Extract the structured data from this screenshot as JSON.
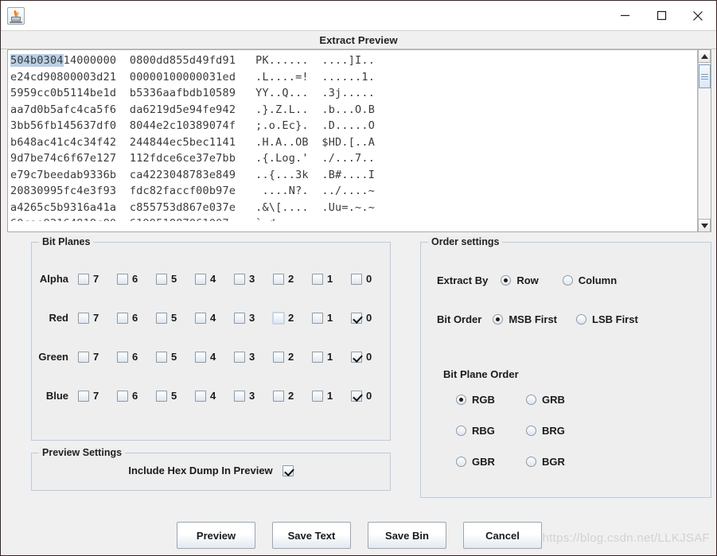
{
  "window": {
    "app_icon": "java-coffee-cup-icon",
    "caption": "Extract Preview",
    "minimize": "—",
    "maximize": "□",
    "close": "✕"
  },
  "preview": {
    "selection": "504b0304",
    "lines": [
      {
        "hex1": "504b0304",
        "hex1_rest": "14000000",
        "hex2": "0800dd855d49fd91",
        "ascii": "PK......  ....]I.."
      },
      {
        "hex1": "",
        "hex1_rest": "e24cd90800003d21",
        "hex2": "00000100000031ed",
        "ascii": ".L....=!  ......1."
      },
      {
        "hex1": "",
        "hex1_rest": "5959cc0b5114be1d",
        "hex2": "b5336aafbdb10589",
        "ascii": "YY..Q...  .3j....."
      },
      {
        "hex1": "",
        "hex1_rest": "aa7d0b5afc4ca5f6",
        "hex2": "da6219d5e94fe942",
        "ascii": ".}.Z.L..  .b...O.B"
      },
      {
        "hex1": "",
        "hex1_rest": "3bb56fb145637df0",
        "hex2": "8044e2c10389074f",
        "ascii": ";.o.Ec}.  .D.....O"
      },
      {
        "hex1": "",
        "hex1_rest": "b648ac41c4c34f42",
        "hex2": "244844ec5bec1141",
        "ascii": ".H.A..OB  $HD.[..A"
      },
      {
        "hex1": "",
        "hex1_rest": "9d7be74c6f67e127",
        "hex2": "112fdce6ce37e7bb",
        "ascii": ".{.Log.'  ./...7.."
      },
      {
        "hex1": "",
        "hex1_rest": "e79c7beedab9336b",
        "hex2": "ca4223048783e849",
        "ascii": "..{...3k  .B#....I"
      },
      {
        "hex1": "",
        "hex1_rest": "20830995fc4e3f93",
        "hex2": "fdc82faccf00b97e",
        "ascii": " ....N?.  ../....~"
      },
      {
        "hex1": "",
        "hex1_rest": "a4265c5b9316a41a",
        "hex2": "c855753d867e037e",
        "ascii": ".&\\[....  .Uu=.~.~"
      }
    ],
    "scrollbar": {
      "up_arrow": "scroll-up-arrow-icon",
      "down_arrow": "scroll-down-arrow-icon"
    }
  },
  "bit_planes": {
    "legend": "Bit Planes",
    "bits": [
      "7",
      "6",
      "5",
      "4",
      "3",
      "2",
      "1",
      "0"
    ],
    "rows": [
      {
        "label": "Alpha",
        "checked": [
          false,
          false,
          false,
          false,
          false,
          false,
          false,
          false
        ],
        "focused_index": -1
      },
      {
        "label": "Red",
        "checked": [
          false,
          false,
          false,
          false,
          false,
          false,
          false,
          true
        ],
        "focused_index": 5
      },
      {
        "label": "Green",
        "checked": [
          false,
          false,
          false,
          false,
          false,
          false,
          false,
          true
        ],
        "focused_index": -1
      },
      {
        "label": "Blue",
        "checked": [
          false,
          false,
          false,
          false,
          false,
          false,
          false,
          true
        ],
        "focused_index": -1
      }
    ]
  },
  "preview_settings": {
    "legend": "Preview Settings",
    "include_hex_dump_label": "Include Hex Dump In Preview",
    "include_hex_dump_checked": true
  },
  "order_settings": {
    "legend": "Order settings",
    "extract_by": {
      "label": "Extract By",
      "options": [
        "Row",
        "Column"
      ],
      "selected": "Row"
    },
    "bit_order": {
      "label": "Bit Order",
      "options": [
        "MSB First",
        "LSB First"
      ],
      "selected": "MSB First"
    },
    "bit_plane_order": {
      "label": "Bit Plane Order",
      "options": [
        "RGB",
        "GRB",
        "RBG",
        "BRG",
        "GBR",
        "BGR"
      ],
      "selected": "RGB"
    }
  },
  "buttons": [
    {
      "label": "Preview"
    },
    {
      "label": "Save Text"
    },
    {
      "label": "Save Bin"
    },
    {
      "label": "Cancel"
    }
  ],
  "watermark": "https://blog.csdn.net/LLKJSAF"
}
